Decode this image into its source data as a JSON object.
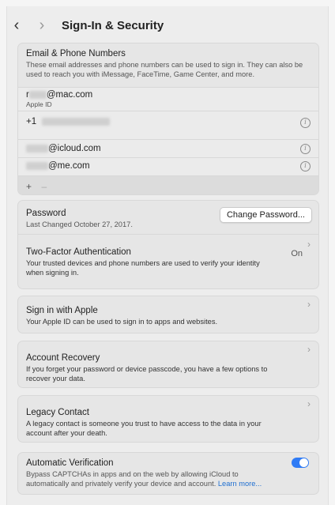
{
  "header": {
    "back_icon": "chevron-left-icon",
    "forward_icon": "chevron-right-icon",
    "title": "Sign-In & Security"
  },
  "email_phone": {
    "title": "Email & Phone Numbers",
    "description": "These email addresses and phone numbers can be used to sign in. They can also be used to reach you with iMessage, FaceTime, Game Center, and more.",
    "apple_id_prefix": "r",
    "apple_id_domain": "@mac.com",
    "apple_id_label": "Apple ID",
    "phone_prefix": "+1",
    "icloud_domain": "@icloud.com",
    "me_domain": "@me.com",
    "add_label": "+",
    "remove_label": "–"
  },
  "password": {
    "title": "Password",
    "last_changed": "Last Changed October 27, 2017.",
    "change_button": "Change Password..."
  },
  "two_factor": {
    "title": "Two-Factor Authentication",
    "status": "On",
    "description": "Your trusted devices and phone numbers are used to verify your identity when signing in."
  },
  "sign_in_apple": {
    "title": "Sign in with Apple",
    "description": "Your Apple ID can be used to sign in to apps and websites."
  },
  "account_recovery": {
    "title": "Account Recovery",
    "description": "If you forget your password or device passcode, you have a few options to recover your data."
  },
  "legacy_contact": {
    "title": "Legacy Contact",
    "description": "A legacy contact is someone you trust to have access to the data in your account after your death."
  },
  "auto_verification": {
    "title": "Automatic Verification",
    "description": "Bypass CAPTCHAs in apps and on the web by allowing iCloud to automatically and privately verify your device and account.",
    "learn_more": "Learn more...",
    "enabled": true
  },
  "colors": {
    "accent": "#2f7bf5",
    "link": "#1f6fd1"
  }
}
